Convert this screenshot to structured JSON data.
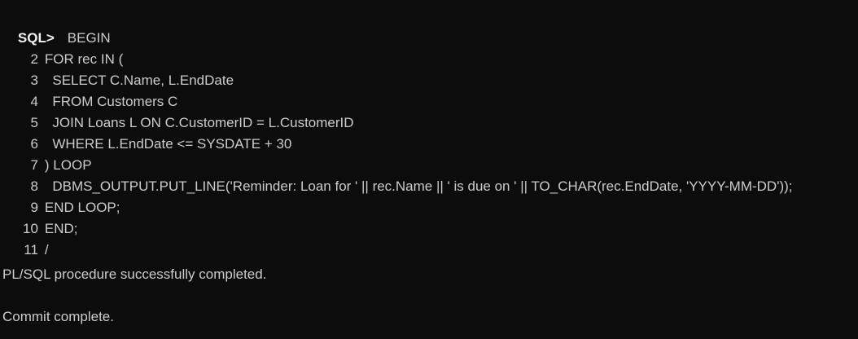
{
  "terminal": {
    "prompt": "SQL>",
    "first_line": "BEGIN",
    "lines": [
      {
        "no": "2",
        "text": "FOR rec IN ("
      },
      {
        "no": "3",
        "text": "  SELECT C.Name, L.EndDate"
      },
      {
        "no": "4",
        "text": "  FROM Customers C"
      },
      {
        "no": "5",
        "text": "  JOIN Loans L ON C.CustomerID = L.CustomerID"
      },
      {
        "no": "6",
        "text": "  WHERE L.EndDate <= SYSDATE + 30"
      },
      {
        "no": "7",
        "text": ") LOOP"
      },
      {
        "no": "8",
        "text": "  DBMS_OUTPUT.PUT_LINE('Reminder: Loan for ' || rec.Name || ' is due on ' || TO_CHAR(rec.EndDate, 'YYYY-MM-DD'));"
      },
      {
        "no": "9",
        "text": "END LOOP;"
      },
      {
        "no": "10",
        "text": "END;"
      },
      {
        "no": "11",
        "text": "/"
      }
    ],
    "output": [
      "PL/SQL procedure successfully completed.",
      "Commit complete."
    ]
  },
  "colors": {
    "background": "#0c0c0c",
    "text": "#cccccc",
    "prompt": "#f2f2f2"
  }
}
